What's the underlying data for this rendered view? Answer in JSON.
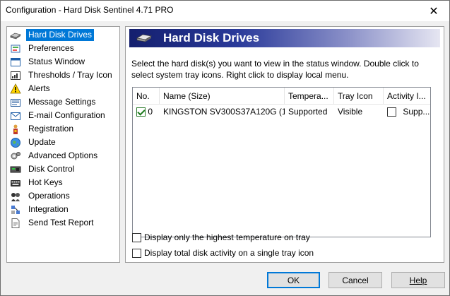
{
  "window": {
    "title": "Configuration  -  Hard Disk Sentinel 4.71 PRO",
    "close_glyph": "✕"
  },
  "sidebar": {
    "items": [
      {
        "label": "Hard Disk Drives",
        "icon": "disk-icon",
        "selected": true
      },
      {
        "label": "Preferences",
        "icon": "preferences-icon"
      },
      {
        "label": "Status Window",
        "icon": "window-icon"
      },
      {
        "label": "Thresholds / Tray Icon",
        "icon": "thresholds-icon"
      },
      {
        "label": "Alerts",
        "icon": "warning-icon"
      },
      {
        "label": "Message Settings",
        "icon": "message-icon"
      },
      {
        "label": "E-mail Configuration",
        "icon": "email-icon"
      },
      {
        "label": "Registration",
        "icon": "registration-icon"
      },
      {
        "label": "Update",
        "icon": "globe-icon"
      },
      {
        "label": "Advanced Options",
        "icon": "advanced-icon"
      },
      {
        "label": "Disk Control",
        "icon": "disk-control-icon"
      },
      {
        "label": "Hot Keys",
        "icon": "keyboard-icon"
      },
      {
        "label": "Operations",
        "icon": "operations-icon"
      },
      {
        "label": "Integration",
        "icon": "integration-icon"
      },
      {
        "label": "Send Test Report",
        "icon": "report-icon"
      }
    ]
  },
  "main": {
    "header": "Hard Disk Drives",
    "description": "Select the hard disk(s) you want to view in the status window. Double click to select system tray icons. Right click to display local menu.",
    "table": {
      "columns": [
        "No.",
        "Name (Size)",
        "Tempera...",
        "Tray Icon",
        "Activity I..."
      ],
      "rows": [
        {
          "checked": true,
          "no": "0",
          "name": "KINGSTON SV300S37A120G (1...",
          "temperature": "Supported",
          "tray_icon": "Visible",
          "activity_checked": false,
          "activity": "Supp..."
        }
      ]
    },
    "options": [
      {
        "label": "Display only the highest temperature on tray",
        "checked": false
      },
      {
        "label": "Display total disk activity on a single tray icon",
        "checked": false
      }
    ]
  },
  "buttons": {
    "ok": "OK",
    "cancel": "Cancel",
    "help": "Help"
  },
  "colors": {
    "selection": "#0078d7",
    "banner_dark": "#141f6e",
    "check_green": "#1a7a1a"
  }
}
